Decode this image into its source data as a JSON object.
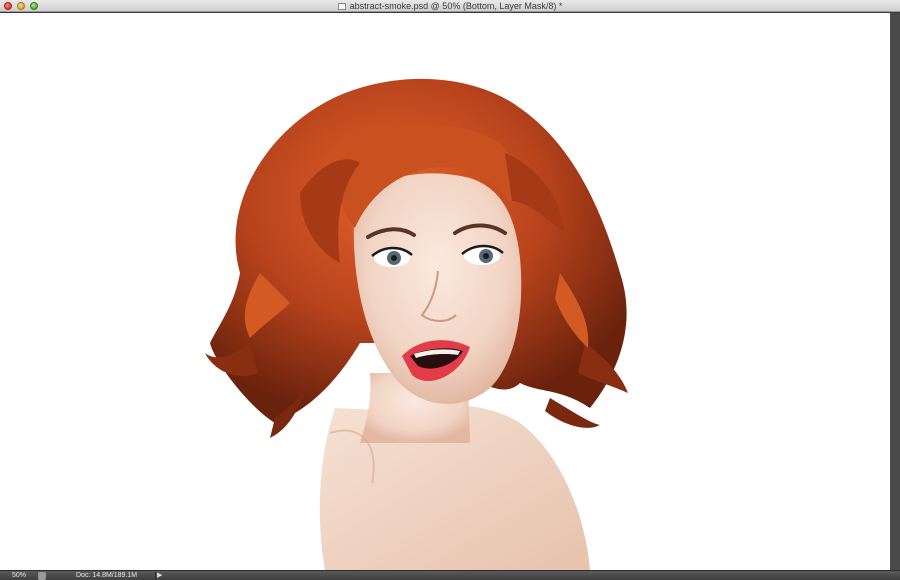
{
  "window": {
    "title": "abstract-smoke.psd @ 50% (Bottom, Layer Mask/8) *"
  },
  "status_bar": {
    "zoom": "50%",
    "doc_size": "Doc: 14.8M/189.1M",
    "menu_arrow": "▶"
  },
  "canvas": {
    "background_color": "#ffffff",
    "content": "photo-portrait"
  },
  "colors": {
    "hair": "#b8431c",
    "skin": "#f3d9c9",
    "lips": "#e23c4a"
  },
  "icons": [
    "close-button-icon",
    "minimize-button-icon",
    "zoom-button-icon",
    "document-icon",
    "status-info-icon",
    "status-menu-arrow-icon"
  ]
}
